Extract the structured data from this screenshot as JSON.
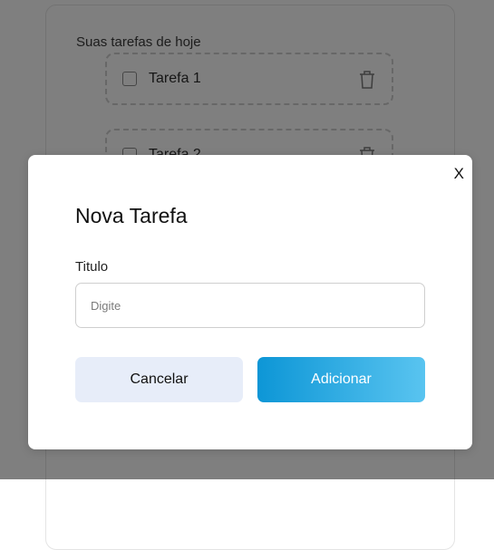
{
  "background": {
    "section_title": "Suas tarefas de hoje",
    "tasks": [
      {
        "label": "Tarefa 1"
      },
      {
        "label": "Tarefa 2"
      }
    ]
  },
  "modal": {
    "close_label": "X",
    "title": "Nova Tarefa",
    "field_label": "Titulo",
    "input_placeholder": "Digite",
    "input_value": "",
    "cancel_label": "Cancelar",
    "add_label": "Adicionar"
  },
  "colors": {
    "accent_start": "#0d96d6",
    "accent_end": "#59c4f0",
    "cancel_bg": "#e7edf9"
  }
}
